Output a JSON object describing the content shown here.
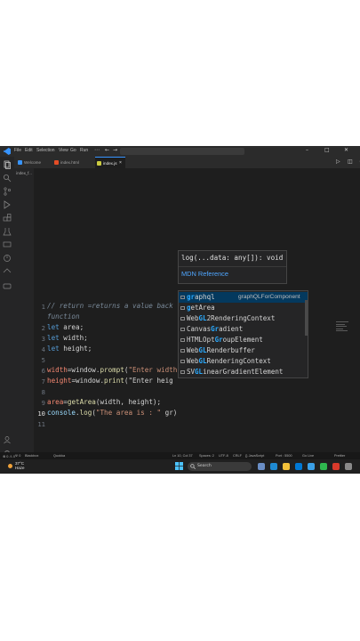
{
  "titlebar": {
    "menu": [
      "File",
      "Edit",
      "Selection",
      "View",
      "Go",
      "Run"
    ]
  },
  "tabs": [
    {
      "label": "Welcome",
      "color": "#3794ff"
    },
    {
      "label": "index.html",
      "color": "#e44d26"
    },
    {
      "label": "index.js",
      "color": "#cbcb41",
      "active": true
    }
  ],
  "sidebar": {
    "label": "index_f..."
  },
  "editor": {
    "lines": [
      {
        "n": "1",
        "text": "// return =returns a value back to the place where you invoked a"
      },
      {
        "n": "",
        "text": "function"
      },
      {
        "n": "2",
        "text": "let area;"
      },
      {
        "n": "3",
        "text": "let width;"
      },
      {
        "n": "4",
        "text": "let height;"
      },
      {
        "n": "5",
        "text": ""
      },
      {
        "n": "6",
        "text": "width=window.prompt(\"Enter width\");"
      },
      {
        "n": "7",
        "text": "height=window.print(\"Enter heig"
      },
      {
        "n": "8",
        "text": ""
      },
      {
        "n": "9",
        "text": "area=getArea(width, height);"
      },
      {
        "n": "10",
        "text": "console.log(\"The area is : \" gr)"
      },
      {
        "n": "11",
        "text": ""
      }
    ]
  },
  "hint": {
    "signature": "log(...data: any[]): void",
    "link": "MDN Reference"
  },
  "suggestions": [
    {
      "label": "graphql",
      "detail": "graphQLForComponent"
    },
    {
      "label": "getArea",
      "detail": ""
    },
    {
      "label": "WebGL2RenderingContext",
      "detail": ""
    },
    {
      "label": "CanvasGradient",
      "detail": ""
    },
    {
      "label": "HTMLOptGroupElement",
      "detail": ""
    },
    {
      "label": "WebGLRenderbuffer",
      "detail": ""
    },
    {
      "label": "WebGLRenderingContext",
      "detail": ""
    },
    {
      "label": "SVGLinearGradientElement",
      "detail": ""
    }
  ],
  "status": {
    "left": [
      "⊗ 0 ⚠ 0",
      "Ψ 0",
      "Blackbox",
      "Quokka"
    ],
    "right": [
      "Ln 10, Col 37",
      "Spaces: 2",
      "UTF-8",
      "CRLF",
      "{} JavaScript",
      "Port : 5500",
      "Go Live",
      "Prettier"
    ]
  },
  "taskbar": {
    "temp": "37°C",
    "condition": "Haze",
    "search_placeholder": "Search"
  },
  "colors": {
    "editor_bg": "#1e1e1e",
    "accent": "#3794ff",
    "selection": "#04395e"
  }
}
